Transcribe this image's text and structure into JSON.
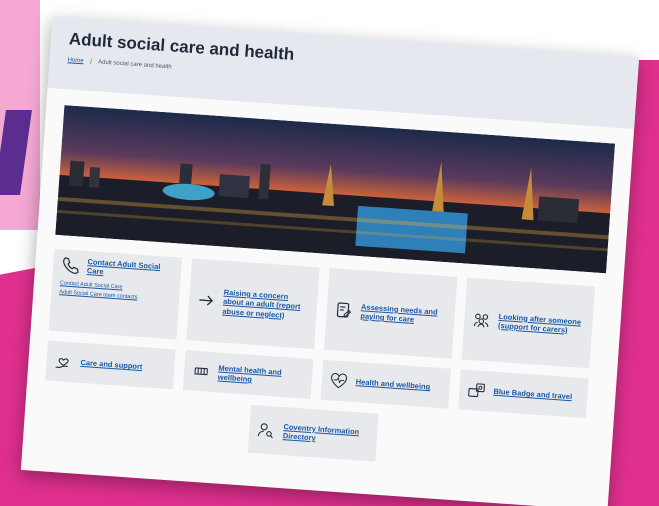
{
  "page": {
    "title": "Adult social care and health",
    "breadcrumb": {
      "home": "Home",
      "separator": "|",
      "current": "Adult social care and health"
    }
  },
  "tiles": {
    "contact": {
      "label": "Contact Adult Social Care",
      "link1": "Contact Adult Social Care",
      "link2": "Adult Social Care team contacts",
      "icon": "phone-icon"
    },
    "raising_concern": {
      "label": "Raising a concern about an adult (report abuse or neglect)",
      "icon": "arrow-right-icon"
    },
    "assessing": {
      "label": "Assessing needs and paying for care",
      "icon": "form-icon"
    },
    "looking_after": {
      "label": "Looking after someone (support for carers)",
      "icon": "people-group-icon"
    },
    "care_support": {
      "label": "Care and support",
      "icon": "hand-heart-icon"
    },
    "mental_health": {
      "label": "Mental health and wellbeing",
      "icon": "brain-icon"
    },
    "health": {
      "label": "Health and wellbeing",
      "icon": "heartbeat-icon"
    },
    "blue_badge": {
      "label": "Blue Badge and travel",
      "icon": "badge-car-icon"
    },
    "coventry": {
      "label": "Coventry Information Directory",
      "icon": "person-search-icon"
    }
  },
  "colors": {
    "accent_magenta": "#e0308f",
    "accent_pink": "#f4a8d2",
    "accent_purple": "#5b2d8e",
    "link": "#1a58a6",
    "tile_bg": "#e8e9ec"
  }
}
